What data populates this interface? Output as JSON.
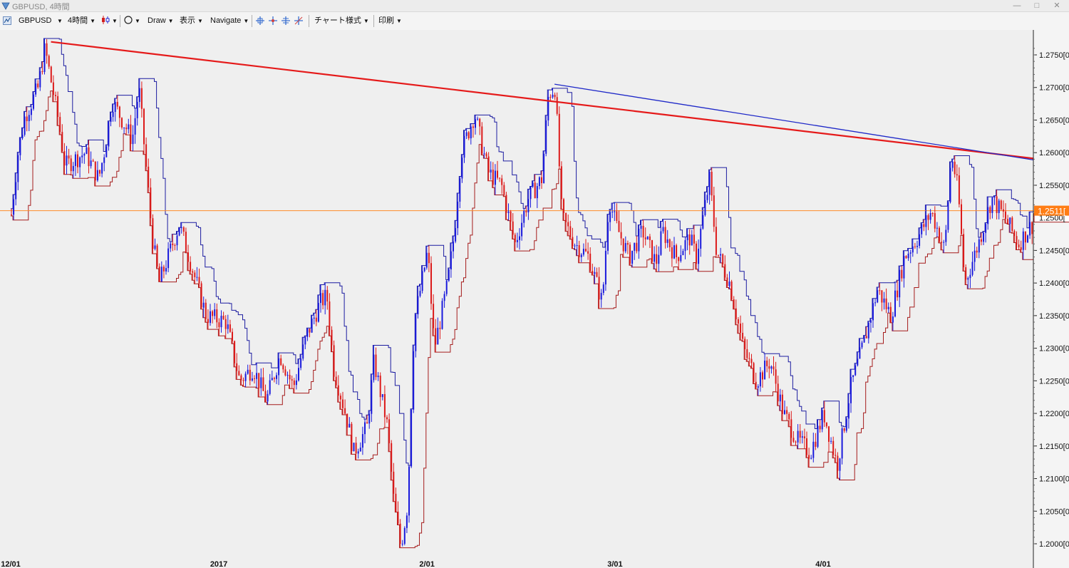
{
  "window": {
    "title": "GBPUSD, 4時間"
  },
  "toolbar": {
    "symbol": "GBPUSD",
    "timeframe": "4時間",
    "draw": "Draw",
    "view": "表示",
    "navigate": "Navigate",
    "chart_style": "チャート様式",
    "print": "印刷"
  },
  "icons": [
    "app-logo-icon",
    "chart-type-icon",
    "circle-tool-icon",
    "crosshair-icon",
    "minimize-icon",
    "maximize-icon",
    "close-icon",
    "down-arrow-icon"
  ],
  "colors": {
    "background": "#efefef",
    "bull_candle": "#1a1adc",
    "bear_candle": "#dc1a1a",
    "upper_band": "#1c1ca0",
    "lower_band": "#a51c1c",
    "price_line": "#ff8c28",
    "resistance_red": "#e51a1a",
    "resistance_blue": "#1e28c8",
    "arrow": "#ee1c1c",
    "price_label_bg": "#ff7d14"
  },
  "chart_data": {
    "type": "candlestick",
    "symbol": "GBPUSD",
    "timeframe": "4時間",
    "ylim": [
      1.1975,
      1.2785
    ],
    "y_ticks": [
      "1.2750[0",
      "1.2700[0",
      "1.2650[0",
      "1.2600[0",
      "1.2550[0",
      "1.2500[0",
      "1.2450[0",
      "1.2400[0",
      "1.2350[0",
      "1.2300[0",
      "1.2250[0",
      "1.2200[0",
      "1.2150[0",
      "1.2100[0",
      "1.2050[0",
      "1.2000[0"
    ],
    "x_ticks": [
      "12/01",
      "2017",
      "2/01",
      "3/01",
      "4/01"
    ],
    "current_price": 1.2511,
    "current_price_label": "1.2511[",
    "secondary_price_label": "1.2500[",
    "path_points": [
      [
        "2016-12-01",
        1.2505
      ],
      [
        "2016-12-02",
        1.26
      ],
      [
        "2016-12-03",
        1.2655
      ],
      [
        "2016-12-05",
        1.27
      ],
      [
        "2016-12-06",
        1.276
      ],
      [
        "2016-12-08",
        1.265
      ],
      [
        "2016-12-09",
        1.258
      ],
      [
        "2016-12-12",
        1.26
      ],
      [
        "2016-12-14",
        1.256
      ],
      [
        "2016-12-15",
        1.261
      ],
      [
        "2016-12-16",
        1.268
      ],
      [
        "2016-12-19",
        1.262
      ],
      [
        "2016-12-20",
        1.27
      ],
      [
        "2016-12-22",
        1.247
      ],
      [
        "2016-12-23",
        1.24
      ],
      [
        "2016-12-26",
        1.249
      ],
      [
        "2016-12-28",
        1.242
      ],
      [
        "2016-12-30",
        1.235
      ],
      [
        "2017-01-02",
        1.234
      ],
      [
        "2017-01-04",
        1.225
      ],
      [
        "2017-01-06",
        1.227
      ],
      [
        "2017-01-08",
        1.222
      ],
      [
        "2017-01-10",
        1.229
      ],
      [
        "2017-01-12",
        1.224
      ],
      [
        "2017-01-14",
        1.232
      ],
      [
        "2017-01-16",
        1.237
      ],
      [
        "2017-01-17",
        1.238
      ],
      [
        "2017-01-18",
        1.227
      ],
      [
        "2017-01-20",
        1.219
      ],
      [
        "2017-01-21",
        1.214
      ],
      [
        "2017-01-23",
        1.218
      ],
      [
        "2017-01-24",
        1.228
      ],
      [
        "2017-01-26",
        1.218
      ],
      [
        "2017-01-27",
        1.206
      ],
      [
        "2017-01-28",
        1.1995
      ],
      [
        "2017-01-29",
        1.206
      ],
      [
        "2017-01-30",
        1.234
      ],
      [
        "2017-02-01",
        1.245
      ],
      [
        "2017-02-02",
        1.23
      ],
      [
        "2017-02-04",
        1.24
      ],
      [
        "2017-02-05",
        1.248
      ],
      [
        "2017-02-06",
        1.26
      ],
      [
        "2017-02-08",
        1.266
      ],
      [
        "2017-02-10",
        1.257
      ],
      [
        "2017-02-12",
        1.255
      ],
      [
        "2017-02-14",
        1.246
      ],
      [
        "2017-02-16",
        1.253
      ],
      [
        "2017-02-18",
        1.256
      ],
      [
        "2017-02-19",
        1.269
      ],
      [
        "2017-02-20",
        1.27
      ],
      [
        "2017-02-21",
        1.25
      ],
      [
        "2017-02-23",
        1.246
      ],
      [
        "2017-02-25",
        1.244
      ],
      [
        "2017-02-27",
        1.237
      ],
      [
        "2017-02-28",
        1.253
      ],
      [
        "2017-03-01",
        1.249
      ],
      [
        "2017-03-03",
        1.244
      ],
      [
        "2017-03-05",
        1.248
      ],
      [
        "2017-03-07",
        1.243
      ],
      [
        "2017-03-08",
        1.248
      ],
      [
        "2017-03-10",
        1.244
      ],
      [
        "2017-03-12",
        1.247
      ],
      [
        "2017-03-13",
        1.244
      ],
      [
        "2017-03-15",
        1.256
      ],
      [
        "2017-03-16",
        1.245
      ],
      [
        "2017-03-18",
        1.24
      ],
      [
        "2017-03-20",
        1.23
      ],
      [
        "2017-03-22",
        1.225
      ],
      [
        "2017-03-24",
        1.228
      ],
      [
        "2017-03-26",
        1.22
      ],
      [
        "2017-03-28",
        1.216
      ],
      [
        "2017-03-30",
        1.214
      ],
      [
        "2017-04-01",
        1.22
      ],
      [
        "2017-04-03",
        1.212
      ],
      [
        "2017-04-05",
        1.224
      ],
      [
        "2017-04-07",
        1.231
      ],
      [
        "2017-04-09",
        1.239
      ],
      [
        "2017-04-11",
        1.235
      ],
      [
        "2017-04-13",
        1.244
      ],
      [
        "2017-04-15",
        1.247
      ],
      [
        "2017-04-17",
        1.251
      ],
      [
        "2017-04-19",
        1.245
      ],
      [
        "2017-04-20",
        1.26
      ],
      [
        "2017-04-21",
        1.254
      ],
      [
        "2017-04-22",
        1.24
      ],
      [
        "2017-04-24",
        1.246
      ],
      [
        "2017-04-26",
        1.253
      ],
      [
        "2017-04-28",
        1.25
      ],
      [
        "2017-04-30",
        1.246
      ],
      [
        "2017-05-02",
        1.249
      ],
      [
        "2017-05-03",
        1.24
      ],
      [
        "2017-05-05",
        1.237
      ],
      [
        "2017-05-07",
        1.238
      ],
      [
        "2017-05-09",
        1.245
      ],
      [
        "2017-05-11",
        1.25
      ],
      [
        "2017-05-12",
        1.257
      ],
      [
        "2017-05-13",
        1.255
      ],
      [
        "2017-05-14",
        1.252
      ],
      [
        "2017-05-15",
        1.2511
      ]
    ],
    "trendlines": [
      {
        "name": "red",
        "color": "#e51a1a",
        "points": [
          [
            "2016-12-07",
            1.277
          ],
          [
            "2017-05-18",
            1.2572
          ]
        ]
      },
      {
        "name": "blue",
        "color": "#1e28c8",
        "points": [
          [
            "2017-02-20",
            1.2705
          ],
          [
            "2017-05-17",
            1.2565
          ]
        ]
      }
    ],
    "horizontal_lines": [
      {
        "price": 1.2511,
        "color": "#ff8c28"
      }
    ],
    "annotations": [
      {
        "type": "down-arrow",
        "x": "2017-05-15",
        "y": 1.2595,
        "color": "#ee1c1c"
      }
    ]
  }
}
